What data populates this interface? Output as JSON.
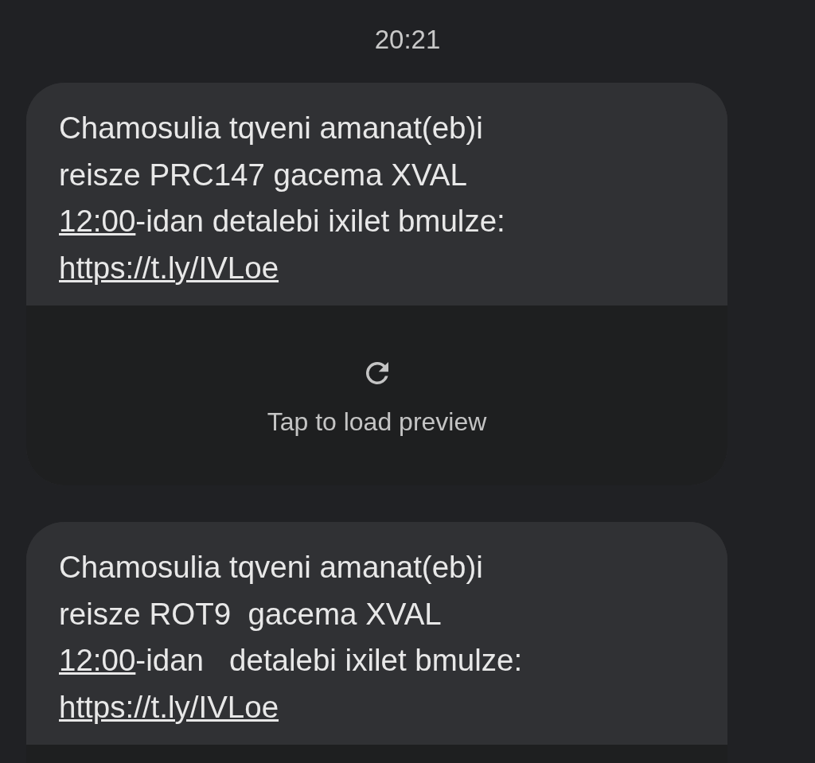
{
  "timestamp": "20:21",
  "messages": [
    {
      "lines": [
        [
          {
            "kind": "text",
            "text": "Chamosulia tqveni amanat(eb)i"
          }
        ],
        [
          {
            "kind": "text",
            "text": "reisze PRC147 gacema XVAL"
          }
        ],
        [
          {
            "kind": "link",
            "text": "12:00"
          },
          {
            "kind": "text",
            "text": "-idan detalebi ixilet bmulze:"
          }
        ],
        [
          {
            "kind": "link",
            "text": "https://t.ly/IVLoe"
          }
        ]
      ],
      "preview": true,
      "preview_label": "Tap to load preview"
    },
    {
      "lines": [
        [
          {
            "kind": "text",
            "text": "Chamosulia tqveni amanat(eb)i"
          }
        ],
        [
          {
            "kind": "text",
            "text": "reisze ROT9  gacema XVAL"
          }
        ],
        [
          {
            "kind": "link",
            "text": "12:00"
          },
          {
            "kind": "text",
            "text": "-idan   detalebi ixilet bmulze:"
          }
        ],
        [
          {
            "kind": "link",
            "text": "https://t.ly/IVLoe"
          }
        ]
      ],
      "preview": true
    }
  ]
}
